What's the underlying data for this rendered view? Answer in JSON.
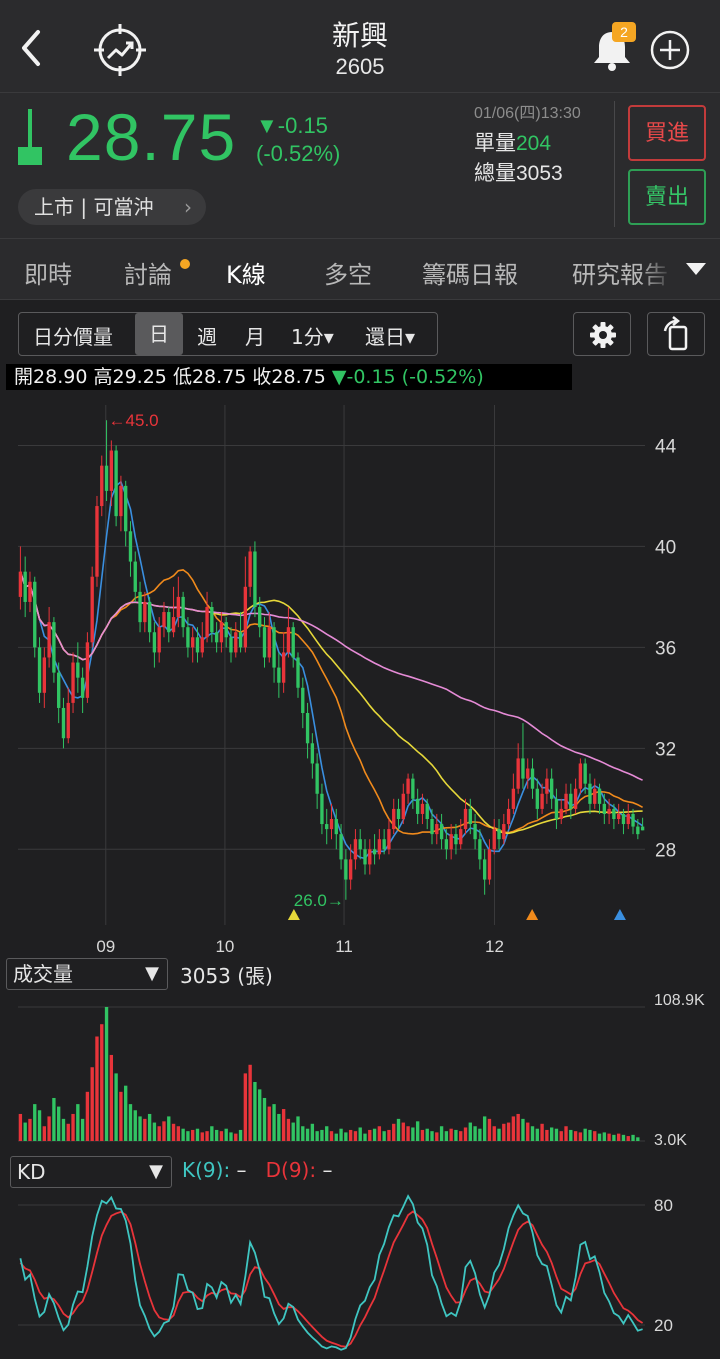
{
  "header": {
    "title": "新興",
    "code": "2605",
    "notification_count": "2"
  },
  "quote": {
    "price": "28.75",
    "change": "▼-0.15",
    "change_pct": "(-0.52%)",
    "datetime": "01/06(四)13:30",
    "unit_volume_label": "單量",
    "unit_volume": "204",
    "total_volume_label": "總量",
    "total_volume": "3053",
    "market_label": "上市 | 可當沖",
    "buy_label": "買進",
    "sell_label": "賣出"
  },
  "tabs": [
    "即時",
    "討論",
    "K線",
    "多空",
    "籌碼日報",
    "研究報告"
  ],
  "active_tab": "K線",
  "period": {
    "items": [
      "日分價量",
      "日",
      "週",
      "月",
      "1分▾",
      "還日▾"
    ],
    "active": "日"
  },
  "ohlc": {
    "open_label": "開",
    "open": "28.90",
    "high_label": "高",
    "high": "29.25",
    "low_label": "低",
    "low": "28.75",
    "close_label": "收",
    "close": "28.75",
    "change": "▼-0.15 (-0.52%)"
  },
  "colors": {
    "up": "#e8343a",
    "down": "#31c463",
    "ma_fast": "#3a8fe0",
    "ma_mid": "#f08a1c",
    "ma_slow": "#e6d83a",
    "ma_long": "#e58bd6",
    "k_line": "#3fc6c2",
    "d_line": "#e8343a"
  },
  "volume_panel": {
    "selector": "成交量",
    "info": "3053 (張)"
  },
  "kd_panel": {
    "selector": "KD",
    "k_label": "K(9):",
    "k_value": "–",
    "d_label": "D(9):",
    "d_value": "–"
  },
  "chart_data": {
    "type": "candlestick",
    "months": [
      "09",
      "10",
      "11",
      "12"
    ],
    "price_axis": {
      "ylim": [
        25.0,
        46.0
      ],
      "ticks": [
        44,
        40,
        36,
        32,
        28
      ]
    },
    "max_marker": "←45.0",
    "min_marker": "26.0→",
    "candles": [
      [
        38.0,
        39.0,
        40.0,
        37.5
      ],
      [
        39.0,
        37.8,
        39.6,
        37.2
      ],
      [
        37.8,
        38.6,
        39.0,
        37.4
      ],
      [
        38.6,
        36.0,
        38.8,
        35.6
      ],
      [
        36.0,
        34.2,
        36.4,
        33.8
      ],
      [
        34.2,
        35.6,
        36.0,
        33.6
      ],
      [
        35.6,
        37.0,
        37.6,
        35.2
      ],
      [
        37.0,
        35.0,
        37.2,
        34.6
      ],
      [
        35.0,
        33.6,
        35.4,
        33.0
      ],
      [
        33.6,
        32.4,
        34.0,
        32.0
      ],
      [
        32.4,
        33.8,
        34.4,
        32.2
      ],
      [
        33.8,
        35.4,
        35.8,
        33.4
      ],
      [
        35.4,
        34.8,
        36.2,
        34.2
      ],
      [
        34.8,
        34.0,
        35.2,
        33.4
      ],
      [
        34.0,
        36.2,
        36.6,
        33.8
      ],
      [
        36.2,
        38.8,
        39.2,
        36.0
      ],
      [
        38.8,
        41.6,
        42.0,
        38.4
      ],
      [
        41.6,
        43.2,
        43.6,
        41.2
      ],
      [
        43.2,
        42.2,
        45.0,
        41.8
      ],
      [
        42.2,
        43.8,
        44.2,
        41.6
      ],
      [
        43.8,
        41.2,
        44.0,
        40.8
      ],
      [
        41.2,
        42.4,
        42.8,
        40.6
      ],
      [
        42.4,
        40.6,
        42.6,
        40.0
      ],
      [
        40.6,
        39.4,
        41.0,
        38.8
      ],
      [
        39.4,
        38.2,
        39.8,
        37.8
      ],
      [
        38.2,
        37.0,
        38.6,
        36.6
      ],
      [
        37.0,
        37.8,
        38.2,
        36.6
      ],
      [
        37.8,
        36.6,
        38.0,
        36.2
      ],
      [
        36.6,
        35.8,
        37.0,
        35.2
      ],
      [
        35.8,
        36.8,
        37.2,
        35.4
      ],
      [
        36.8,
        37.4,
        37.8,
        36.4
      ],
      [
        37.4,
        36.6,
        37.6,
        36.2
      ],
      [
        36.6,
        37.2,
        38.4,
        36.4
      ],
      [
        37.2,
        38.0,
        38.8,
        36.8
      ],
      [
        38.0,
        36.8,
        38.2,
        36.4
      ],
      [
        36.8,
        36.0,
        37.2,
        35.6
      ],
      [
        36.0,
        36.4,
        36.8,
        35.4
      ],
      [
        36.4,
        35.8,
        36.8,
        35.4
      ],
      [
        35.8,
        36.4,
        37.0,
        35.6
      ],
      [
        36.4,
        37.6,
        38.2,
        36.2
      ],
      [
        37.6,
        36.6,
        37.8,
        36.2
      ],
      [
        36.6,
        36.2,
        37.0,
        35.8
      ],
      [
        36.2,
        37.0,
        37.4,
        35.8
      ],
      [
        37.0,
        36.4,
        37.2,
        36.0
      ],
      [
        36.4,
        35.8,
        36.8,
        35.4
      ],
      [
        35.8,
        36.6,
        37.0,
        35.6
      ],
      [
        36.6,
        36.0,
        37.4,
        35.8
      ],
      [
        36.0,
        38.4,
        39.6,
        35.8
      ],
      [
        38.4,
        39.8,
        40.0,
        38.0
      ],
      [
        39.8,
        37.6,
        40.2,
        37.2
      ],
      [
        37.6,
        36.8,
        38.0,
        36.4
      ],
      [
        36.8,
        35.6,
        37.2,
        35.2
      ],
      [
        35.6,
        36.8,
        37.4,
        35.4
      ],
      [
        36.8,
        35.2,
        37.0,
        34.6
      ],
      [
        35.2,
        34.6,
        35.8,
        34.0
      ],
      [
        34.6,
        35.8,
        36.6,
        34.2
      ],
      [
        35.8,
        36.8,
        37.6,
        35.6
      ],
      [
        36.8,
        35.6,
        37.0,
        35.2
      ],
      [
        35.6,
        34.4,
        35.8,
        34.0
      ],
      [
        34.4,
        33.4,
        34.8,
        32.8
      ],
      [
        33.4,
        32.2,
        33.8,
        31.6
      ],
      [
        32.2,
        31.4,
        32.6,
        30.8
      ],
      [
        31.4,
        30.2,
        31.8,
        29.6
      ],
      [
        30.2,
        29.0,
        30.6,
        28.6
      ],
      [
        29.0,
        28.8,
        29.6,
        28.2
      ],
      [
        28.8,
        29.2,
        29.8,
        28.4
      ],
      [
        29.2,
        28.6,
        29.6,
        28.0
      ],
      [
        28.6,
        27.6,
        29.0,
        27.2
      ],
      [
        27.6,
        26.8,
        28.0,
        26.0
      ],
      [
        26.8,
        27.6,
        28.2,
        26.4
      ],
      [
        27.6,
        28.4,
        28.8,
        27.2
      ],
      [
        28.4,
        28.0,
        28.8,
        27.6
      ],
      [
        28.0,
        27.4,
        28.4,
        27.0
      ],
      [
        27.4,
        28.0,
        28.4,
        27.0
      ],
      [
        28.0,
        27.8,
        28.6,
        27.4
      ],
      [
        27.8,
        28.4,
        28.8,
        27.6
      ],
      [
        28.4,
        28.0,
        28.8,
        27.8
      ],
      [
        28.0,
        28.8,
        29.2,
        27.8
      ],
      [
        28.8,
        29.6,
        30.0,
        28.6
      ],
      [
        29.6,
        29.2,
        30.0,
        28.8
      ],
      [
        29.2,
        30.2,
        30.6,
        29.0
      ],
      [
        30.2,
        30.8,
        31.0,
        29.8
      ],
      [
        30.8,
        30.0,
        31.0,
        29.6
      ],
      [
        30.0,
        29.4,
        30.4,
        29.0
      ],
      [
        29.4,
        29.8,
        30.2,
        29.0
      ],
      [
        29.8,
        29.2,
        30.0,
        28.8
      ],
      [
        29.2,
        28.6,
        29.6,
        28.2
      ],
      [
        28.6,
        29.0,
        29.4,
        28.2
      ],
      [
        29.0,
        28.4,
        29.4,
        28.0
      ],
      [
        28.4,
        28.0,
        28.8,
        27.6
      ],
      [
        28.0,
        28.6,
        29.0,
        27.6
      ],
      [
        28.6,
        28.2,
        29.0,
        27.8
      ],
      [
        28.2,
        28.8,
        29.2,
        28.0
      ],
      [
        28.8,
        29.6,
        30.0,
        28.6
      ],
      [
        29.6,
        29.0,
        30.0,
        28.6
      ],
      [
        29.0,
        28.4,
        29.4,
        28.0
      ],
      [
        28.4,
        27.6,
        28.8,
        27.2
      ],
      [
        27.6,
        26.8,
        28.0,
        26.2
      ],
      [
        26.8,
        28.0,
        28.4,
        26.6
      ],
      [
        28.0,
        28.8,
        29.2,
        27.8
      ],
      [
        28.8,
        28.4,
        29.2,
        28.0
      ],
      [
        28.4,
        29.0,
        29.4,
        28.2
      ],
      [
        29.0,
        29.6,
        30.0,
        28.8
      ],
      [
        29.6,
        30.4,
        31.0,
        29.4
      ],
      [
        30.4,
        31.6,
        32.2,
        30.2
      ],
      [
        31.6,
        30.8,
        33.0,
        30.4
      ],
      [
        30.8,
        31.2,
        31.6,
        30.4
      ],
      [
        31.2,
        30.4,
        31.6,
        30.0
      ],
      [
        30.4,
        29.6,
        30.8,
        29.2
      ],
      [
        29.6,
        30.2,
        30.6,
        29.4
      ],
      [
        30.2,
        30.8,
        31.2,
        29.8
      ],
      [
        30.8,
        30.0,
        31.2,
        29.6
      ],
      [
        30.0,
        29.2,
        30.4,
        28.8
      ],
      [
        29.2,
        29.6,
        30.0,
        29.0
      ],
      [
        29.6,
        30.2,
        30.6,
        29.4
      ],
      [
        30.2,
        29.6,
        30.6,
        29.2
      ],
      [
        29.6,
        30.4,
        30.8,
        29.4
      ],
      [
        30.4,
        31.4,
        31.6,
        30.2
      ],
      [
        31.4,
        30.6,
        31.6,
        30.2
      ],
      [
        30.6,
        29.8,
        31.0,
        29.4
      ],
      [
        29.8,
        30.4,
        30.8,
        29.6
      ],
      [
        30.4,
        29.8,
        30.6,
        29.4
      ],
      [
        29.8,
        29.4,
        30.2,
        29.0
      ],
      [
        29.4,
        29.6,
        30.0,
        29.0
      ],
      [
        29.6,
        29.2,
        29.8,
        28.8
      ],
      [
        29.2,
        29.4,
        29.8,
        29.0
      ],
      [
        29.4,
        29.0,
        29.6,
        28.6
      ],
      [
        29.0,
        29.4,
        29.8,
        28.8
      ],
      [
        29.4,
        28.9,
        29.6,
        28.6
      ],
      [
        28.9,
        28.6,
        29.2,
        28.4
      ],
      [
        28.9,
        28.75,
        29.25,
        28.75
      ]
    ],
    "volume": [
      22,
      15,
      18,
      30,
      25,
      12,
      20,
      35,
      28,
      18,
      14,
      22,
      30,
      18,
      40,
      60,
      85,
      95,
      109,
      70,
      55,
      40,
      45,
      30,
      25,
      20,
      18,
      22,
      15,
      12,
      16,
      20,
      14,
      12,
      10,
      8,
      9,
      10,
      7,
      8,
      12,
      9,
      8,
      10,
      7,
      6,
      9,
      55,
      62,
      48,
      42,
      35,
      28,
      30,
      22,
      26,
      18,
      15,
      20,
      12,
      10,
      14,
      8,
      9,
      12,
      8,
      6,
      10,
      7,
      9,
      8,
      11,
      6,
      9,
      10,
      12,
      8,
      9,
      14,
      18,
      15,
      12,
      11,
      16,
      9,
      10,
      8,
      7,
      12,
      8,
      10,
      9,
      8,
      11,
      15,
      12,
      10,
      20,
      18,
      12,
      10,
      14,
      15,
      20,
      22,
      18,
      15,
      12,
      10,
      14,
      9,
      11,
      10,
      8,
      12,
      9,
      8,
      7,
      10,
      9,
      8,
      6,
      7,
      6,
      5,
      6,
      5,
      4,
      5,
      3
    ]
  }
}
